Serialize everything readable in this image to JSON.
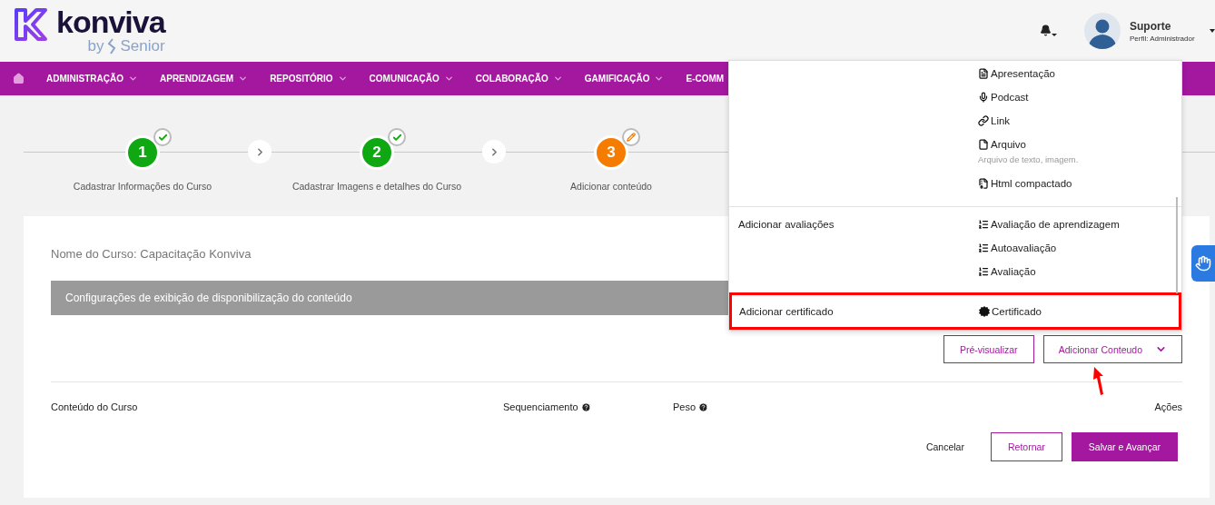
{
  "header": {
    "logo": {
      "name": "konviva",
      "byline": "by",
      "brand": "Senior"
    },
    "user": {
      "name": "Suporte",
      "profile": "Perfil: Administrador"
    }
  },
  "nav": {
    "items": [
      {
        "label": "ADMINISTRAÇÃO",
        "caret": true
      },
      {
        "label": "APRENDIZAGEM",
        "caret": true
      },
      {
        "label": "REPOSITÓRIO",
        "caret": true
      },
      {
        "label": "COMUNICAÇÃO",
        "caret": true
      },
      {
        "label": "COLABORAÇÃO",
        "caret": true
      },
      {
        "label": "GAMIFICAÇÃO",
        "caret": true
      },
      {
        "label": "E-COMM",
        "caret": false
      }
    ]
  },
  "stepper": {
    "steps": [
      {
        "number": "1",
        "label": "Cadastrar Informações do Curso",
        "completed": true
      },
      {
        "number": "2",
        "label": "Cadastrar Imagens e detalhes do Curso",
        "completed": true
      },
      {
        "number": "3",
        "label": "Adicionar conteúdo",
        "completed": false
      }
    ]
  },
  "course": {
    "title": "Nome do Curso: Capacitação Konviva",
    "config_bar": "Configurações de exibição de disponibilização do conteúdo"
  },
  "actions": [
    {
      "label": "Pré-visualizar",
      "caret": false
    },
    {
      "label": "Adicionar Conteudo",
      "caret": true
    }
  ],
  "table": {
    "columns": [
      {
        "label": "Conteúdo do Curso",
        "help": false
      },
      {
        "label": "Sequenciamento",
        "help": true
      },
      {
        "label": "Peso",
        "help": true
      },
      {
        "label": "Ações",
        "help": false
      }
    ]
  },
  "footer_buttons": [
    {
      "label": "Cancelar",
      "kind": "text"
    },
    {
      "label": "Retornar",
      "kind": "outline"
    },
    {
      "label": "Salvar e Avançar",
      "kind": "primary"
    }
  ],
  "dropdown": {
    "sections": [
      {
        "highlighted": false,
        "items": [
          {
            "label": "Apresentação",
            "kind": "presentation"
          },
          {
            "label": "Podcast",
            "kind": "microphone"
          },
          {
            "label": "Link",
            "kind": "link"
          },
          {
            "label": "Arquivo",
            "kind": "file",
            "hint": "Arquivo de texto, imagem."
          },
          {
            "label": "Html compactado",
            "kind": "archive"
          }
        ]
      },
      {
        "label": "Adicionar avaliações",
        "highlighted": false,
        "items": [
          {
            "label": "Avaliação de aprendizagem",
            "kind": "list"
          },
          {
            "label": "Autoavaliação",
            "kind": "list"
          },
          {
            "label": "Avaliação",
            "kind": "list"
          }
        ]
      },
      {
        "label": "Adicionar certificado",
        "highlighted": true,
        "items": [
          {
            "label": "Certificado",
            "kind": "seal"
          }
        ]
      }
    ]
  }
}
